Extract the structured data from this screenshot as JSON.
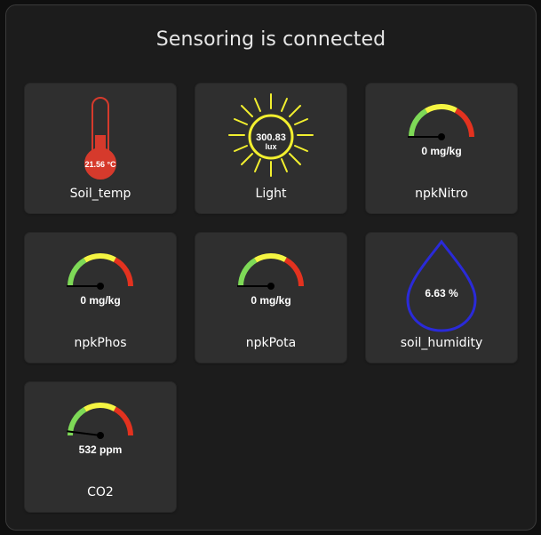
{
  "title": "Sensoring is connected",
  "colors": {
    "gauge_low": "#7ed957",
    "gauge_mid": "#f5f542",
    "gauge_high": "#e3321f",
    "thermo": "#d63a2c",
    "sun": "#f2ef2f",
    "drop": "#2a2ad8"
  },
  "tiles": [
    {
      "label": "Soil_temp",
      "icon": "thermometer-icon",
      "value": "21.56 °C"
    },
    {
      "label": "Light",
      "icon": "sun-icon",
      "value": "300.83",
      "unit": "lux"
    },
    {
      "label": "npkNitro",
      "icon": "gauge-icon",
      "value": "0 mg/kg",
      "level": 0
    },
    {
      "label": "npkPhos",
      "icon": "gauge-icon",
      "value": "0 mg/kg",
      "level": 0
    },
    {
      "label": "npkPota",
      "icon": "gauge-icon",
      "value": "0 mg/kg",
      "level": 0
    },
    {
      "label": "soil_humidity",
      "icon": "water-drop-icon",
      "value": "6.63 %"
    },
    {
      "label": "CO2",
      "icon": "gauge-icon",
      "value": "532 ppm",
      "level": 0.04
    }
  ]
}
